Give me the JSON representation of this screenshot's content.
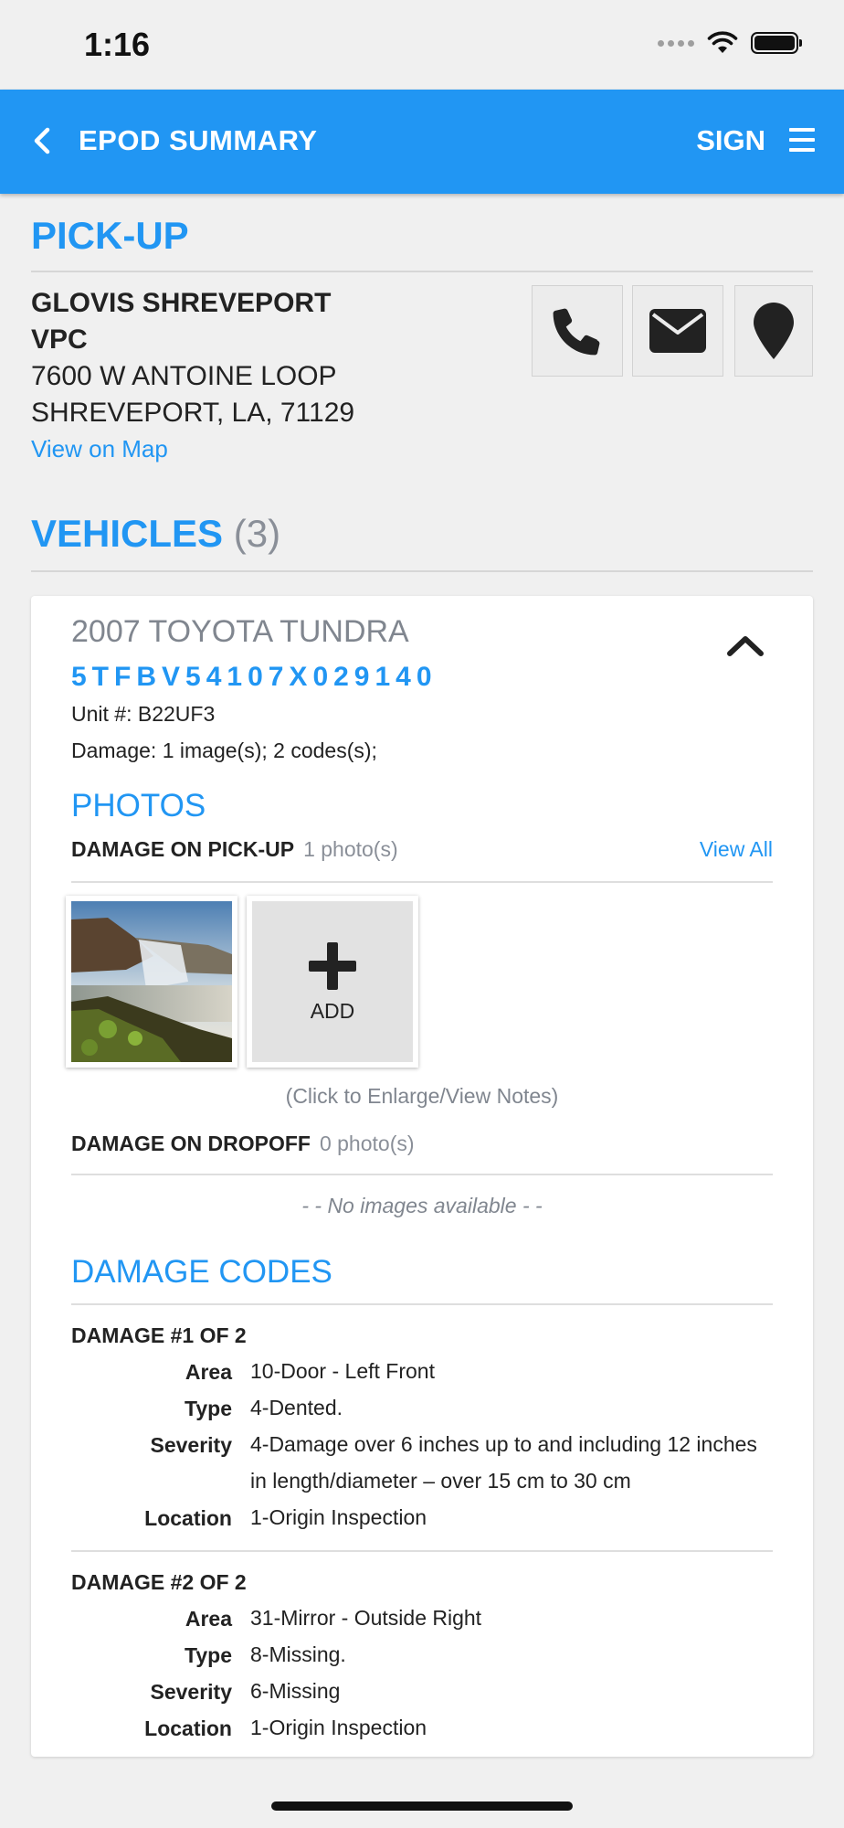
{
  "status": {
    "time": "1:16"
  },
  "header": {
    "title": "EPOD SUMMARY",
    "sign_label": "SIGN"
  },
  "pickup": {
    "section_title": "PICK-UP",
    "name_line1": "GLOVIS SHREVEPORT",
    "name_line2": "VPC",
    "address_line1": "7600 W ANTOINE LOOP",
    "address_line2": "SHREVEPORT, LA, 71129",
    "view_map": "View on Map"
  },
  "vehicles": {
    "section_title": "VEHICLES",
    "count": "(3)",
    "items": [
      {
        "title": "2007 TOYOTA TUNDRA",
        "vin": "5TFBV54107X029140",
        "unit": "Unit #: B22UF3",
        "damage_summary": "Damage: 1 image(s); 2 codes(s);",
        "photos_title": "PHOTOS",
        "pickup_group": {
          "label": "DAMAGE ON PICK-UP",
          "count": "1 photo(s)",
          "view_all": "View All"
        },
        "add_label": "ADD",
        "click_note": "(Click to Enlarge/View Notes)",
        "dropoff_group": {
          "label": "DAMAGE ON DROPOFF",
          "count": "0 photo(s)"
        },
        "no_images": "- - No images available - -",
        "damage_codes_title": "DAMAGE CODES",
        "labels": {
          "area": "Area",
          "type": "Type",
          "severity": "Severity",
          "location": "Location"
        },
        "damages": [
          {
            "heading": "DAMAGE #1 OF 2",
            "area": "10-Door - Left Front",
            "type": "4-Dented.",
            "severity": "4-Damage over 6 inches up to and including 12 inches in length/diameter – over 15 cm to 30 cm",
            "location": "1-Origin Inspection"
          },
          {
            "heading": "DAMAGE #2 OF 2",
            "area": "31-Mirror - Outside Right",
            "type": "8-Missing.",
            "severity": "6-Missing",
            "location": "1-Origin Inspection"
          }
        ]
      }
    ]
  },
  "icons": {
    "back": "chevron-left-icon",
    "menu": "hamburger-menu-icon",
    "phone": "phone-icon",
    "email": "envelope-icon",
    "map": "map-pin-icon",
    "collapse": "chevron-up-icon",
    "add": "plus-icon"
  },
  "colors": {
    "accent": "#2196f3",
    "background": "#f0f0f0",
    "muted": "#80868f"
  }
}
